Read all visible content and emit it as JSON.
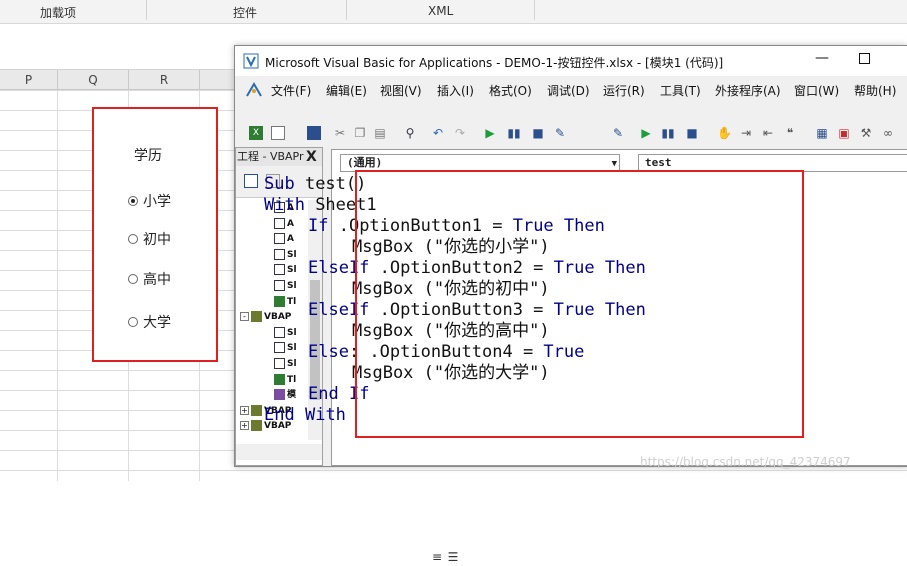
{
  "excel": {
    "ribbon_groups": [
      "加载项",
      "控件",
      "XML"
    ],
    "columns": [
      "P",
      "Q",
      "R"
    ],
    "option_group": {
      "title": "学历",
      "options": [
        {
          "label": "小学",
          "selected": true
        },
        {
          "label": "初中",
          "selected": false
        },
        {
          "label": "高中",
          "selected": false
        },
        {
          "label": "大学",
          "selected": false
        }
      ]
    }
  },
  "vba": {
    "title": "Microsoft Visual Basic for Applications - DEMO-1-按钮控件.xlsx - [模块1 (代码)]",
    "window_controls": {
      "minimize": "—"
    },
    "menu": [
      "文件(F)",
      "编辑(E)",
      "视图(V)",
      "插入(I)",
      "格式(O)",
      "调试(D)",
      "运行(R)",
      "工具(T)",
      "外接程序(A)",
      "窗口(W)",
      "帮助(H)"
    ],
    "project_pane": {
      "title": "工程 - VBAPr",
      "close": "X",
      "tree": [
        {
          "label": "A",
          "icon": "sheet-icon"
        },
        {
          "label": "A",
          "icon": "sheet-icon"
        },
        {
          "label": "A",
          "icon": "sheet-icon"
        },
        {
          "label": "Sl",
          "icon": "sheet-icon"
        },
        {
          "label": "Sl",
          "icon": "sheet-icon"
        },
        {
          "label": "Sl",
          "icon": "sheet-icon"
        },
        {
          "label": "Tl",
          "icon": "workbook-icon"
        },
        {
          "label": "VBAP",
          "icon": "project-icon",
          "expander": "-"
        },
        {
          "label": "Sl",
          "icon": "sheet-icon"
        },
        {
          "label": "Sl",
          "icon": "sheet-icon"
        },
        {
          "label": "Sl",
          "icon": "sheet-icon"
        },
        {
          "label": "Tl",
          "icon": "workbook-icon"
        },
        {
          "label": "模",
          "icon": "module-icon"
        },
        {
          "label": "VBAP",
          "icon": "project-icon",
          "expander": "+"
        },
        {
          "label": "VBAP",
          "icon": "project-icon",
          "expander": "+"
        }
      ]
    },
    "object_combo": "(通用)",
    "proc_combo": "test",
    "code": [
      {
        "indent": 0,
        "parts": [
          {
            "t": "Sub",
            "kw": true
          },
          {
            "t": " test()",
            "kw": false
          }
        ]
      },
      {
        "indent": 0,
        "parts": [
          {
            "t": "With",
            "kw": true
          },
          {
            "t": " Sheet1",
            "kw": false
          }
        ]
      },
      {
        "indent": 1,
        "parts": [
          {
            "t": "If",
            "kw": true
          },
          {
            "t": " .OptionButton1 = ",
            "kw": false
          },
          {
            "t": "True",
            "kw": true
          },
          {
            "t": " ",
            "kw": false
          },
          {
            "t": "Then",
            "kw": true
          }
        ]
      },
      {
        "indent": 2,
        "parts": [
          {
            "t": "MsgBox (\"你选的小学\")",
            "kw": false
          }
        ]
      },
      {
        "indent": 1,
        "parts": [
          {
            "t": "ElseIf",
            "kw": true
          },
          {
            "t": " .OptionButton2 = ",
            "kw": false
          },
          {
            "t": "True",
            "kw": true
          },
          {
            "t": " ",
            "kw": false
          },
          {
            "t": "Then",
            "kw": true
          }
        ]
      },
      {
        "indent": 2,
        "parts": [
          {
            "t": "MsgBox (\"你选的初中\")",
            "kw": false
          }
        ]
      },
      {
        "indent": 1,
        "parts": [
          {
            "t": "ElseIf",
            "kw": true
          },
          {
            "t": " .OptionButton3 = ",
            "kw": false
          },
          {
            "t": "True",
            "kw": true
          },
          {
            "t": " ",
            "kw": false
          },
          {
            "t": "Then",
            "kw": true
          }
        ]
      },
      {
        "indent": 2,
        "parts": [
          {
            "t": "MsgBox (\"你选的高中\")",
            "kw": false
          }
        ]
      },
      {
        "indent": 1,
        "parts": [
          {
            "t": "Else",
            "kw": true
          },
          {
            "t": ": .OptionButton4 = ",
            "kw": false
          },
          {
            "t": "True",
            "kw": true
          }
        ]
      },
      {
        "indent": 2,
        "parts": [
          {
            "t": "MsgBox (\"你选的大学\")",
            "kw": false
          }
        ]
      },
      {
        "indent": 1,
        "parts": [
          {
            "t": "End",
            "kw": true
          },
          {
            "t": " ",
            "kw": false
          },
          {
            "t": "If",
            "kw": true
          }
        ]
      },
      {
        "indent": 0,
        "parts": [
          {
            "t": "End",
            "kw": true
          },
          {
            "t": " ",
            "kw": false
          },
          {
            "t": "With",
            "kw": true
          }
        ]
      }
    ]
  },
  "watermark": "https://blog.csdn.net/qq_42374697",
  "colors": {
    "highlight_box": "#e02020",
    "keyword": "#00008b"
  }
}
